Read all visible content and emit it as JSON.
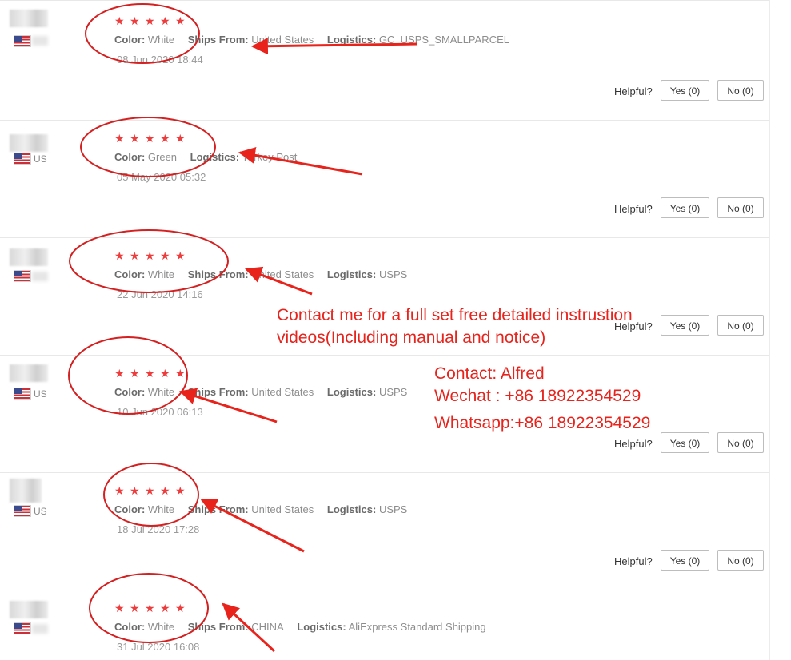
{
  "reviews": [
    {
      "stars": "★★★★★",
      "color_label": "Color:",
      "color": "White",
      "ships_label": "Ships From:",
      "ships": "United States",
      "logistics_label": "Logistics:",
      "logistics": "GC_USPS_SMALLPARCEL",
      "date": "08 Jun 2020 18:44",
      "country": "",
      "helpful": "Helpful?",
      "yes": "Yes (0)",
      "no": "No (0)"
    },
    {
      "stars": "★★★★★",
      "color_label": "Color:",
      "color": "Green",
      "ships_label": "",
      "ships": "",
      "logistics_label": "Logistics:",
      "logistics": "Turkey Post",
      "date": "05 May 2020 05:32",
      "country": "US",
      "helpful": "Helpful?",
      "yes": "Yes (0)",
      "no": "No (0)"
    },
    {
      "stars": "★★★★★",
      "color_label": "Color:",
      "color": "White",
      "ships_label": "Ships From:",
      "ships": "United States",
      "logistics_label": "Logistics:",
      "logistics": "USPS",
      "date": "22 Jun 2020 14:16",
      "country": "",
      "helpful": "Helpful?",
      "yes": "Yes (0)",
      "no": "No (0)"
    },
    {
      "stars": "★★★★★",
      "color_label": "Color:",
      "color": "White",
      "ships_label": "Ships From:",
      "ships": "United States",
      "logistics_label": "Logistics:",
      "logistics": "USPS",
      "date": "10 Jun 2020 06:13",
      "country": "US",
      "helpful": "Helpful?",
      "yes": "Yes (0)",
      "no": "No (0)"
    },
    {
      "stars": "★★★★★",
      "color_label": "Color:",
      "color": "White",
      "ships_label": "Ships From:",
      "ships": "United States",
      "logistics_label": "Logistics:",
      "logistics": "USPS",
      "date": "18 Jul 2020 17:28",
      "country": "US",
      "helpful": "Helpful?",
      "yes": "Yes (0)",
      "no": "No (0)"
    },
    {
      "stars": "★★★★★",
      "color_label": "Color:",
      "color": "White",
      "ships_label": "Ships From:",
      "ships": "CHINA",
      "logistics_label": "Logistics:",
      "logistics": "AliExpress Standard Shipping",
      "date": "31 Jul 2020 16:08",
      "country": "",
      "helpful": "",
      "yes": "",
      "no": ""
    }
  ],
  "overlay": {
    "contact_line1": "Contact me for a full set free detailed instrustion",
    "contact_line2": "videos(Including manual and notice)",
    "contact_name": "Contact: Alfred",
    "wechat": "Wechat : +86 18922354529",
    "whatsapp": "Whatsapp:+86 18922354529"
  },
  "colors": {
    "star": "#ee3b3b",
    "annotation": "#e8231c",
    "divider": "#e8e8e8"
  }
}
